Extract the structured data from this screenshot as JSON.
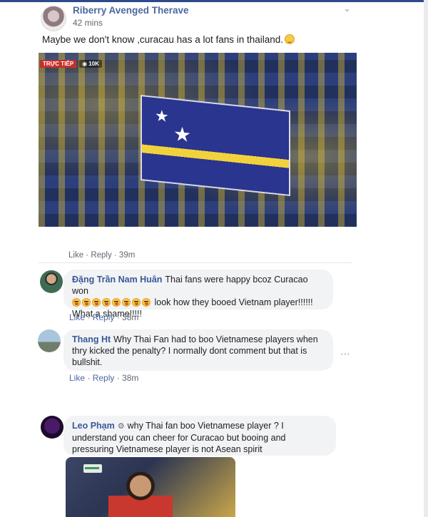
{
  "post": {
    "author": "Riberry Avenged Therave",
    "time": "42 mins",
    "text": "Maybe we don't know ,curacau has a lot fans in thailand.",
    "live_label": "TRỰC TIẾP",
    "viewer_count": "10K"
  },
  "comments_meta": "Like · Reply · 39m",
  "comments": [
    {
      "author": "Đặng Trần Nam Huân",
      "text_before": "Thai fans were happy bcoz Curacao won",
      "emoji_count": 8,
      "text_after": "look how they booed Vietnam player!!!!!! What a shame!!!!!",
      "like": "Like",
      "reply": "Reply",
      "time": "38m"
    },
    {
      "author": "Thang Ht",
      "text": "Why Thai Fan had to boo Vietnamese players when thry kicked the penalty? I normally dont comment but that is bullshit.",
      "like": "Like",
      "reply": "Reply",
      "time": "38m"
    },
    {
      "author": "Leo Phạm",
      "text": "why Thai fan boo Vietnamese player ? I understand you can cheer for Curacao but booing and pressuring Vietnamese player is not Asean spirit"
    }
  ],
  "colors": {
    "name_blue": "#385898",
    "bubble_bg": "#f2f3f5",
    "meta_gray": "#606770",
    "live_red": "#c4302b"
  }
}
